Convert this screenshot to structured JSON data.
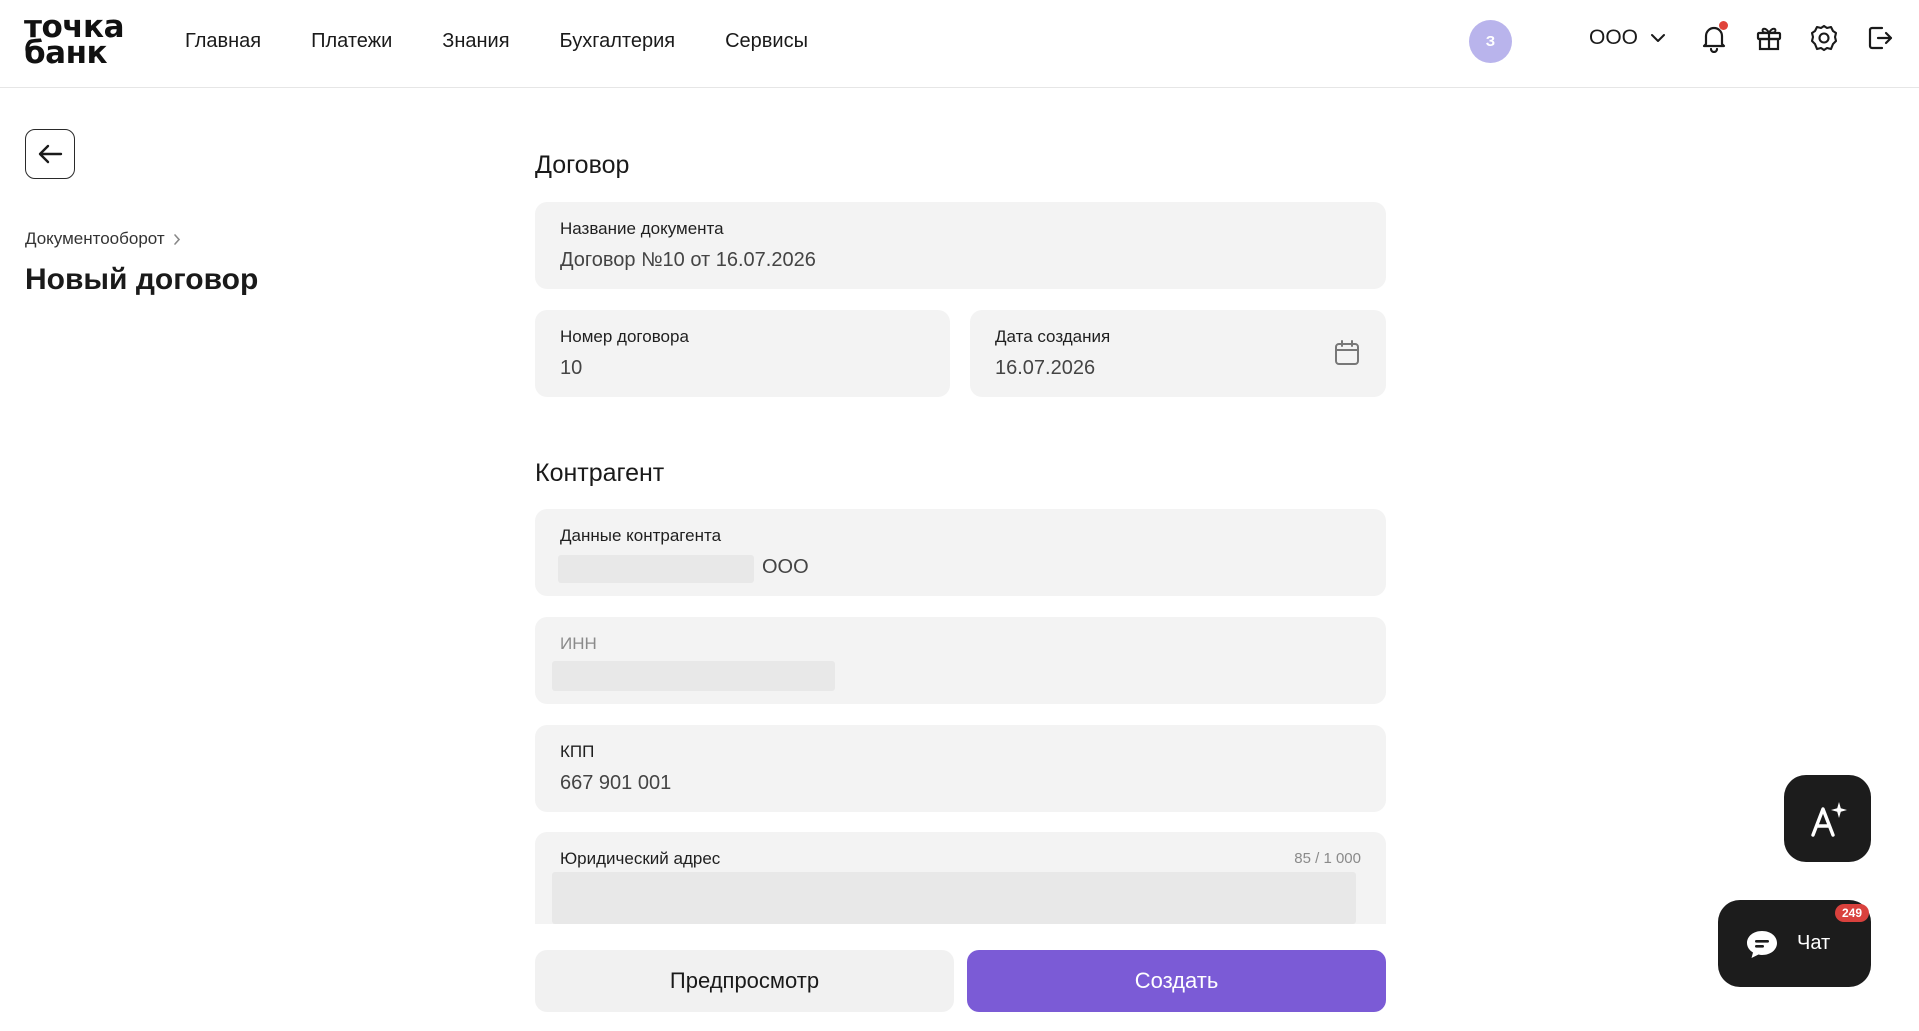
{
  "brand": {
    "line1": "точка",
    "line2": "банк"
  },
  "nav": {
    "items": [
      "Главная",
      "Платежи",
      "Знания",
      "Бухгалтерия",
      "Сервисы"
    ]
  },
  "header": {
    "avatar_initial": "З",
    "company_name": "ООО",
    "icons": [
      "bell-icon",
      "gift-icon",
      "gear-icon",
      "logout-icon"
    ],
    "accent_avatar": "#b9b4ec",
    "notification_dot_color": "#e0433a"
  },
  "breadcrumb": {
    "label": "Документооборот"
  },
  "page": {
    "title": "Новый договор"
  },
  "form": {
    "contract_section": "Договор",
    "doc_name": {
      "label": "Название документа",
      "value": "Договор №10 от 16.07.2026"
    },
    "contract_number": {
      "label": "Номер договора",
      "value": "10"
    },
    "creation_date": {
      "label": "Дата создания",
      "value": "16.07.2026"
    },
    "counterparty_section": "Контрагент",
    "counterparty_data": {
      "label": "Данные контрагента",
      "value": "ООО"
    },
    "inn": {
      "label": "ИНН"
    },
    "kpp": {
      "label": "КПП",
      "value": "667 901 001"
    },
    "legal_address": {
      "label": "Юридический адрес",
      "counter": "85 / 1 000"
    }
  },
  "actions": {
    "preview": "Предпросмотр",
    "create": "Создать",
    "primary_color": "#7b5bd6"
  },
  "floating": {
    "chat_label": "Чат",
    "chat_badge": "249"
  }
}
